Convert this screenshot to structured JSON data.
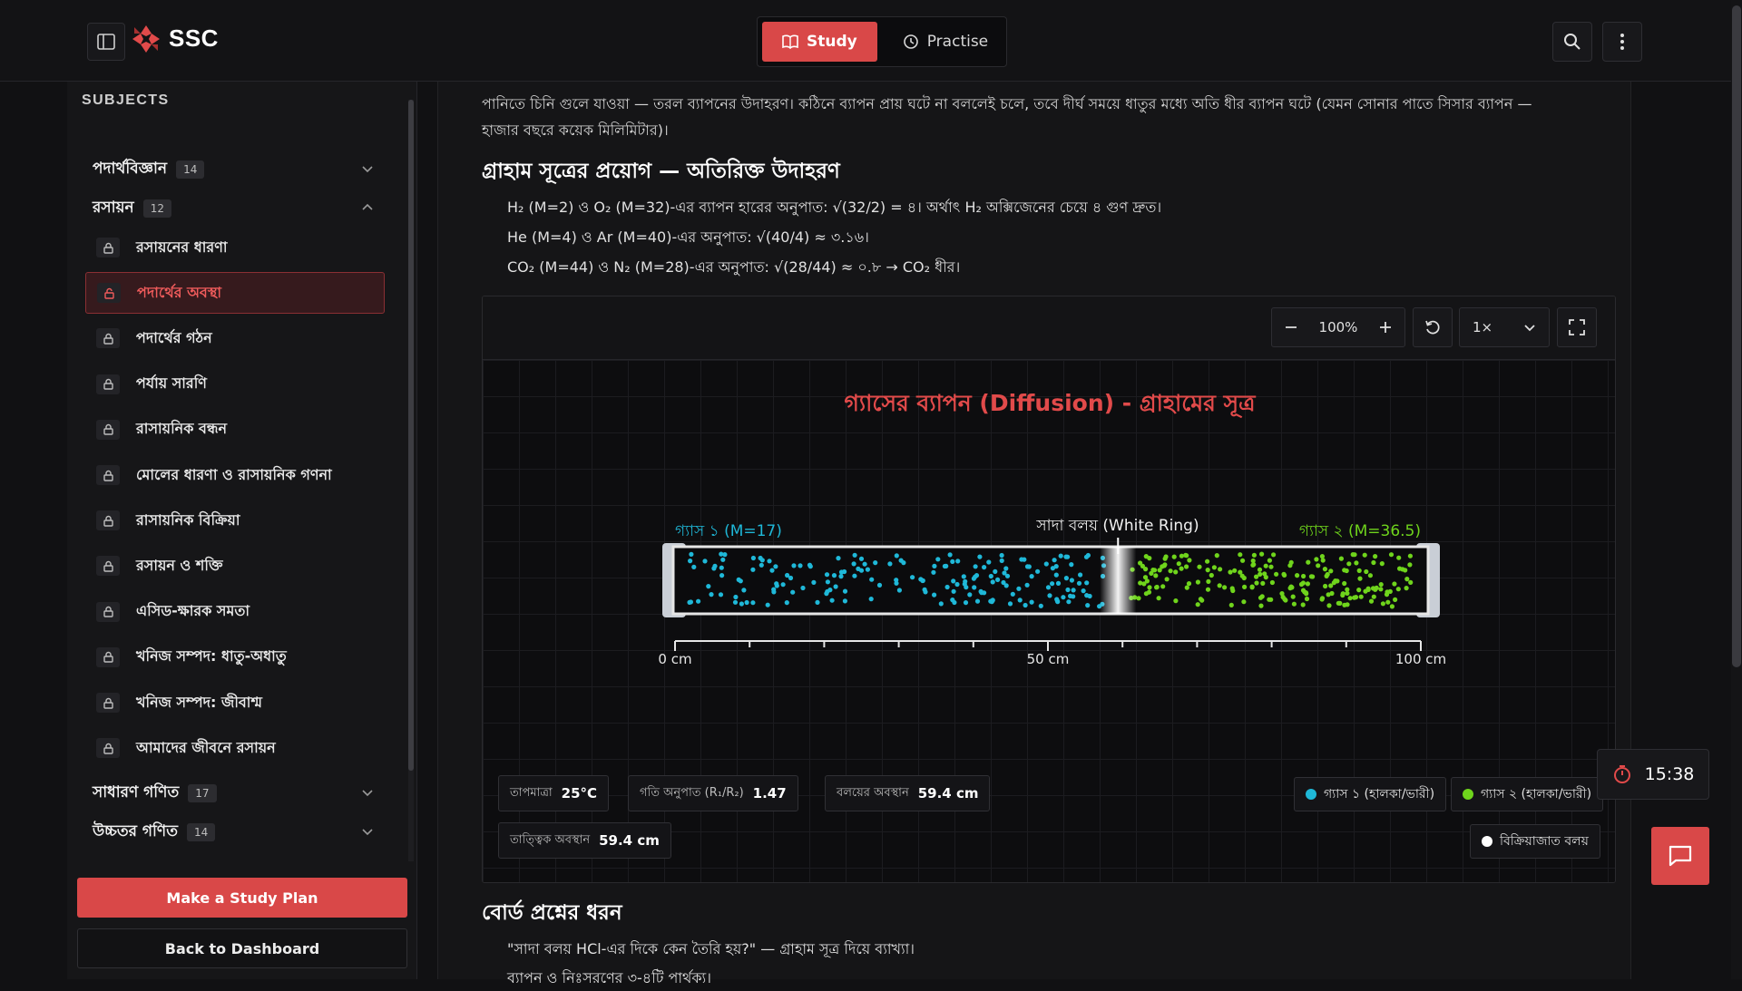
{
  "app": {
    "brand": "SSC"
  },
  "modes": [
    {
      "label": "Study",
      "active": true
    },
    {
      "label": "Practise",
      "active": false
    }
  ],
  "sidebar": {
    "heading": "SUBJECTS",
    "subjects": [
      {
        "name": "পদার্থবিজ্ঞান",
        "count": "14",
        "expanded": false
      },
      {
        "name": "রসায়ন",
        "count": "12",
        "expanded": true
      },
      {
        "name": "সাধারণ গণিত",
        "count": "17",
        "expanded": false
      },
      {
        "name": "উচ্চতর গণিত",
        "count": "14",
        "expanded": false
      }
    ],
    "chapters": [
      "রসায়নের ধারণা",
      "পদার্থের অবস্থা",
      "পদার্থের গঠন",
      "পর্যায় সারণি",
      "রাসায়নিক বন্ধন",
      "মোলের ধারণা ও রাসায়নিক গণনা",
      "রাসায়নিক বিক্রিয়া",
      "রসায়ন ও শক্তি",
      "এসিড-ক্ষারক সমতা",
      "খনিজ সম্পদ: ধাতু-অধাতু",
      "খনিজ সম্পদ: জীবাশ্ম",
      "আমাদের জীবনে রসায়ন"
    ],
    "active_chapter": "পদার্থের অবস্থা",
    "plan_button": "Make a Study Plan",
    "back_button": "Back to Dashboard"
  },
  "content": {
    "para_line1": "পানিতে চিনি গুলে যাওয়া — তরল ব্যাপনের উদাহরণ। কঠিনে ব্যাপন প্রায় ঘটে না বললেই চলে, তবে দীর্ঘ সময়ে ধাতুর মধ্যে অতি ধীর ব্যাপন ঘটে (যেমন সোনার পাতে সিসার ব্যাপন —",
    "para_line2": "হাজার বছরে কয়েক মিলিমিটার)।",
    "section_title": "গ্রাহাম সূত্রের প্রয়োগ — অতিরিক্ত উদাহরণ",
    "bullets": [
      "H₂ (M=2) ও O₂ (M=32)-এর ব্যাপন হারের অনুপাত: √(32/2) = ৪। অর্থাৎ H₂ অক্সিজেনের চেয়ে ৪ গুণ দ্রুত।",
      "He (M=4) ও Ar (M=40)-এর অনুপাত: √(40/4) ≈ ৩.১৬।",
      "CO₂ (M=44) ও N₂ (M=28)-এর অনুপাত: √(28/44) ≈ ০.৮ → CO₂ ধীর।"
    ],
    "board_title": "বোর্ড প্রশ্নের ধরন",
    "board_bullets": [
      "\"সাদা বলয় HCl-এর দিকে কেন তৈরি হয়?\" — গ্রাহাম সূত্র দিয়ে ব্যাখ্যা।",
      "ব্যাপন ও নিঃসরণের ৩-৪টি পার্থক্য।"
    ]
  },
  "sim": {
    "zoom": "100%",
    "speed": "1×",
    "title": "গ্যাসের ব্যাপন (Diffusion) - গ্রাহামের সূত্র",
    "gas1_label": "গ্যাস ১ (M=17)",
    "gas2_label": "গ্যাস ২ (M=36.5)",
    "ring_label": "সাদা বলয় (White Ring)",
    "ring_position_cm": 59.4,
    "axis_labels": [
      "0 cm",
      "50 cm",
      "100 cm"
    ],
    "stats": [
      {
        "label": "তাপমাত্রা",
        "value": "25°C"
      },
      {
        "label": "গতি অনুপাত (R₁/R₂)",
        "value": "1.47"
      },
      {
        "label": "বলয়ের অবস্থান",
        "value": "59.4 cm"
      },
      {
        "label": "তাত্ত্বিক অবস্থান",
        "value": "59.4 cm"
      }
    ],
    "legend": [
      {
        "label": "গ্যাস ১ (হালকা/ভারী)",
        "color": "#1fb8d8"
      },
      {
        "label": "গ্যাস ২ (হালকা/ভারী)",
        "color": "#6fd41c"
      },
      {
        "label": "বিক্রিয়াজাত বলয়",
        "color": "#ffffff"
      }
    ],
    "colors": {
      "title": "#e14a4a",
      "gas1": "#1fb8d8",
      "gas2": "#6fd41c"
    }
  },
  "timer": "15:38",
  "colors": {
    "accent": "#d94848"
  }
}
